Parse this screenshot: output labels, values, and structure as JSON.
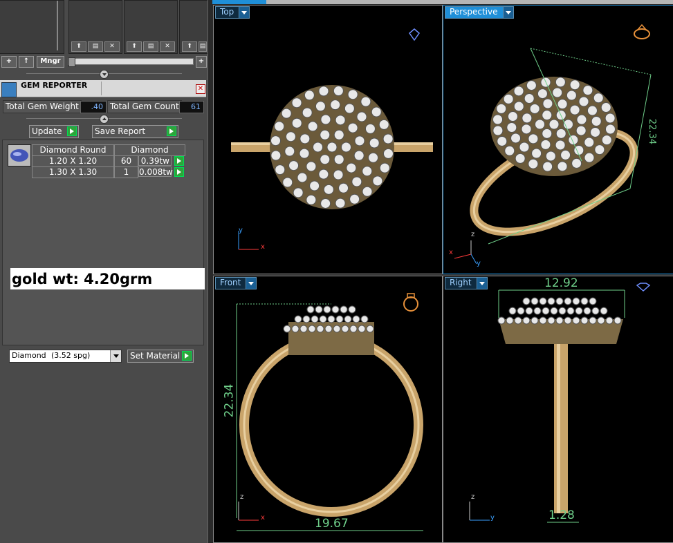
{
  "toolbar": {
    "add_icon": "plus-icon",
    "up_icon": "up-arrow-icon",
    "mngr_label": "Mngr",
    "add_right_icon": "plus-icon"
  },
  "gem_reporter": {
    "title": "GEM REPORTER",
    "total_weight_label": "Total Gem Weight",
    "total_weight_value": ".40",
    "total_count_label": "Total Gem Count",
    "total_count_value": "61",
    "update_label": "Update",
    "save_report_label": "Save Report",
    "table": {
      "col1": "Diamond Round",
      "col2": "Diamond",
      "rows": [
        {
          "size": "1.20 X 1.20",
          "count": "60",
          "weight": "0.39tw"
        },
        {
          "size": "1.30 X 1.30",
          "count": "1",
          "weight": "0.008tw"
        }
      ]
    },
    "note": "gold wt: 4.20grm",
    "material_name": "Diamond",
    "material_sg": "(3.52 spg)",
    "set_material_label": "Set Material"
  },
  "viewports": {
    "top": {
      "label": "Top",
      "axis_y": "y",
      "axis_x": "x"
    },
    "perspective": {
      "label": "Perspective",
      "dim": "22.34",
      "axis_z": "z",
      "axis_x": "x",
      "axis_y": "y"
    },
    "front": {
      "label": "Front",
      "dim_height": "22.34",
      "dim_width": "19.67",
      "axis_z": "z",
      "axis_x": "x"
    },
    "right": {
      "label": "Right",
      "dim_width": "12.92",
      "dim_band": "1.28",
      "axis_z": "z",
      "axis_y": "y"
    }
  },
  "colors": {
    "accent": "#1f8fd8",
    "dimension": "#6fcf8a",
    "gold": "#c9a46a",
    "diamond": "#e8e8e8"
  }
}
